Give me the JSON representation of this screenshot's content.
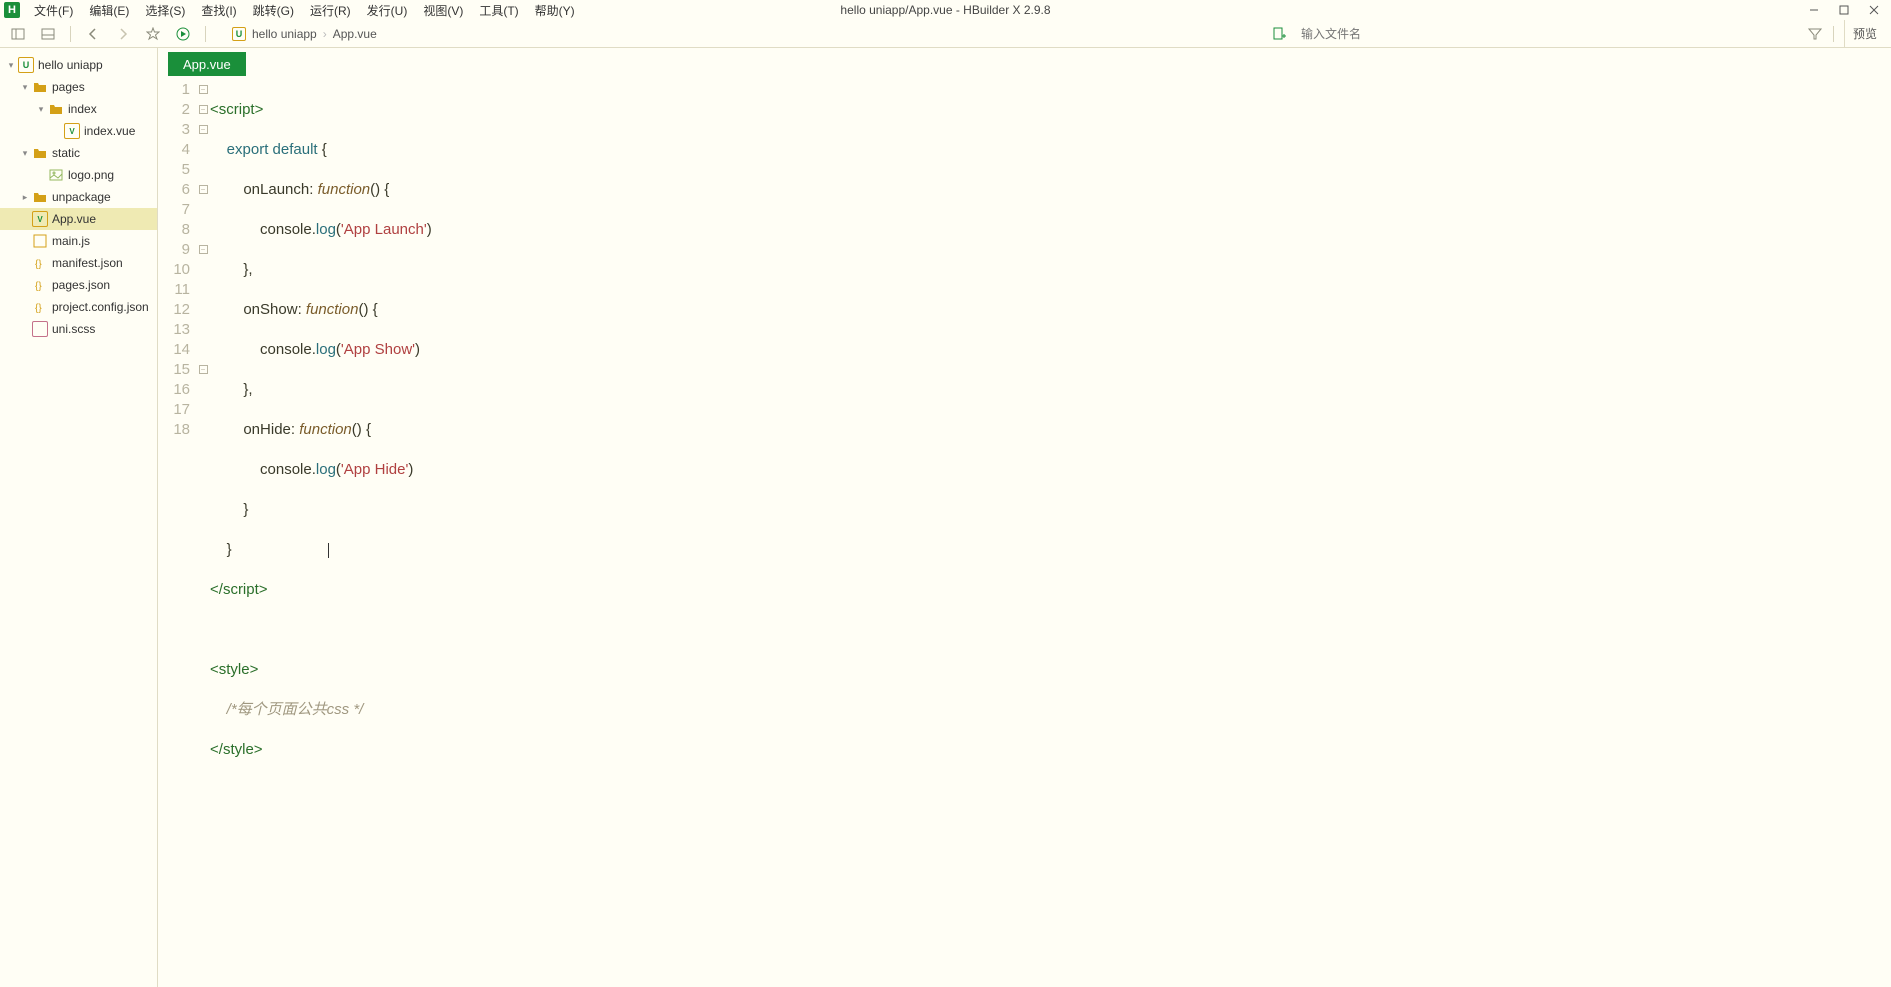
{
  "title": "hello uniapp/App.vue - HBuilder X 2.9.8",
  "menu": {
    "file": "文件(F)",
    "edit": "编辑(E)",
    "select": "选择(S)",
    "find": "查找(I)",
    "goto": "跳转(G)",
    "run": "运行(R)",
    "publish": "发行(U)",
    "view": "视图(V)",
    "tools": "工具(T)",
    "help": "帮助(Y)"
  },
  "toolbar": {
    "filename_placeholder": "输入文件名",
    "preview": "预览"
  },
  "breadcrumb": {
    "project": "hello uniapp",
    "file": "App.vue"
  },
  "tree": {
    "root": "hello uniapp",
    "pages": "pages",
    "index_folder": "index",
    "index_vue": "index.vue",
    "static": "static",
    "logo_png": "logo.png",
    "unpackage": "unpackage",
    "app_vue": "App.vue",
    "main_js": "main.js",
    "manifest_json": "manifest.json",
    "pages_json": "pages.json",
    "project_config": "project.config.json",
    "uni_scss": "uni.scss"
  },
  "tab": {
    "label": "App.vue"
  },
  "code": {
    "l1": {
      "tag_open": "<",
      "tag": "script",
      "tag_close": ">"
    },
    "l2": {
      "kw1": "export",
      "kw2": "default",
      "brace": " {"
    },
    "l3": {
      "prop": "onLaunch",
      "colon": ": ",
      "fn": "function",
      "paren": "() {"
    },
    "l4": {
      "obj": "console",
      "dot": ".",
      "mth": "log",
      "open": "(",
      "str": "'App Launch'",
      "close": ")"
    },
    "l5": {
      "txt": "},"
    },
    "l6": {
      "prop": "onShow",
      "colon": ": ",
      "fn": "function",
      "paren": "() {"
    },
    "l7": {
      "obj": "console",
      "dot": ".",
      "mth": "log",
      "open": "(",
      "str": "'App Show'",
      "close": ")"
    },
    "l8": {
      "txt": "},"
    },
    "l9": {
      "prop": "onHide",
      "colon": ": ",
      "fn": "function",
      "paren": "() {"
    },
    "l10": {
      "obj": "console",
      "dot": ".",
      "mth": "log",
      "open": "(",
      "str": "'App Hide'",
      "close": ")"
    },
    "l11": {
      "txt": "}"
    },
    "l12": {
      "txt": "}"
    },
    "l13": {
      "tag_open": "</",
      "tag": "script",
      "tag_close": ">"
    },
    "l15": {
      "tag_open": "<",
      "tag": "style",
      "tag_close": ">"
    },
    "l16": {
      "com": "/*每个页面公共css */"
    },
    "l17": {
      "tag_open": "</",
      "tag": "style",
      "tag_close": ">"
    }
  },
  "line_numbers": [
    "1",
    "2",
    "3",
    "4",
    "5",
    "6",
    "7",
    "8",
    "9",
    "10",
    "11",
    "12",
    "13",
    "14",
    "15",
    "16",
    "17",
    "18"
  ]
}
